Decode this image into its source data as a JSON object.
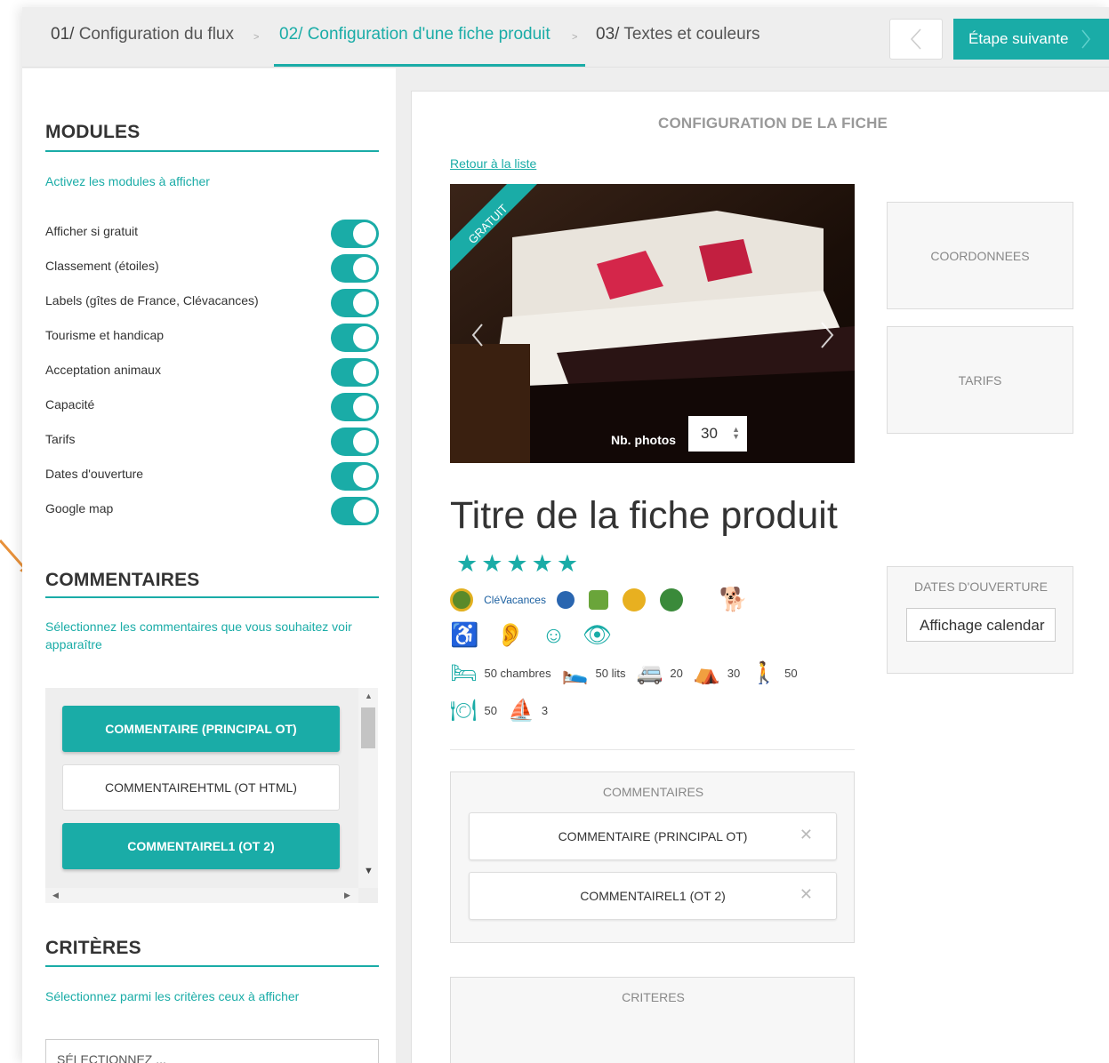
{
  "steps": [
    {
      "num": "01/",
      "label": "Configuration du flux"
    },
    {
      "num": "02/",
      "label": "Configuration d'une fiche produit"
    },
    {
      "num": "03/",
      "label": "Textes et couleurs"
    }
  ],
  "step_separator": ">",
  "nav": {
    "prev_icon": "chevron-left-icon",
    "next_label": "Étape suivante",
    "next_icon": "chevron-right-icon"
  },
  "colors": {
    "accent": "#1aaca7",
    "arrow": "#e8913a"
  },
  "modules": {
    "title": "MODULES",
    "subtitle": "Activez les modules à afficher",
    "items": [
      {
        "label": "Afficher si gratuit",
        "on": true
      },
      {
        "label": "Classement (étoiles)",
        "on": true
      },
      {
        "label": "Labels (gîtes de France, Clévacances)",
        "on": true
      },
      {
        "label": "Tourisme et handicap",
        "on": true
      },
      {
        "label": "Acceptation animaux",
        "on": true
      },
      {
        "label": "Capacité",
        "on": true
      },
      {
        "label": "Tarifs",
        "on": true
      },
      {
        "label": "Dates d'ouverture",
        "on": true
      },
      {
        "label": "Google map",
        "on": true
      }
    ]
  },
  "commentaires": {
    "title": "COMMENTAIRES",
    "subtitle": "Sélectionnez les commentaires que vous souhaitez voir apparaître",
    "items": [
      {
        "label": "COMMENTAIRE (PRINCIPAL OT)",
        "selected": true
      },
      {
        "label": "COMMENTAIREHTML (OT HTML)",
        "selected": false
      },
      {
        "label": "COMMENTAIREL1 (OT 2)",
        "selected": true
      }
    ]
  },
  "criteres": {
    "title": "CRITÈRES",
    "subtitle": "Sélectionnez parmi les critères ceux à afficher",
    "select_placeholder": "SÉLECTIONNEZ ..."
  },
  "preview": {
    "title": "CONFIGURATION DE LA FICHE",
    "back_link": "Retour à la liste",
    "ribbon": "GRATUIT",
    "nb_photos_label": "Nb. photos",
    "nb_photos_value": "30",
    "fiche_title": "Titre de la fiche produit",
    "stars": "★★★★★",
    "labels_text": "CléVacances",
    "capacity": [
      {
        "icon": "bed-icon",
        "value": "50 chambres"
      },
      {
        "icon": "beds-icon",
        "value": "50 lits"
      },
      {
        "icon": "camper-icon",
        "value": "20"
      },
      {
        "icon": "tent-icon",
        "value": "30"
      },
      {
        "icon": "person-icon",
        "value": "50"
      }
    ],
    "capacity2": [
      {
        "icon": "dining-icon",
        "value": "50"
      },
      {
        "icon": "sailboat-icon",
        "value": "3"
      }
    ],
    "comments_box_title": "COMMENTAIRES",
    "comments_cards": [
      {
        "label": "COMMENTAIRE (PRINCIPAL OT)"
      },
      {
        "label": "COMMENTAIREL1 (OT 2)"
      }
    ],
    "criteres_box_title": "CRITERES"
  },
  "side": {
    "coordonnees": "COORDONNEES",
    "tarifs": "TARIFS",
    "dates_title": "DATES D'OUVERTURE",
    "dates_value": "Affichage calendar"
  }
}
